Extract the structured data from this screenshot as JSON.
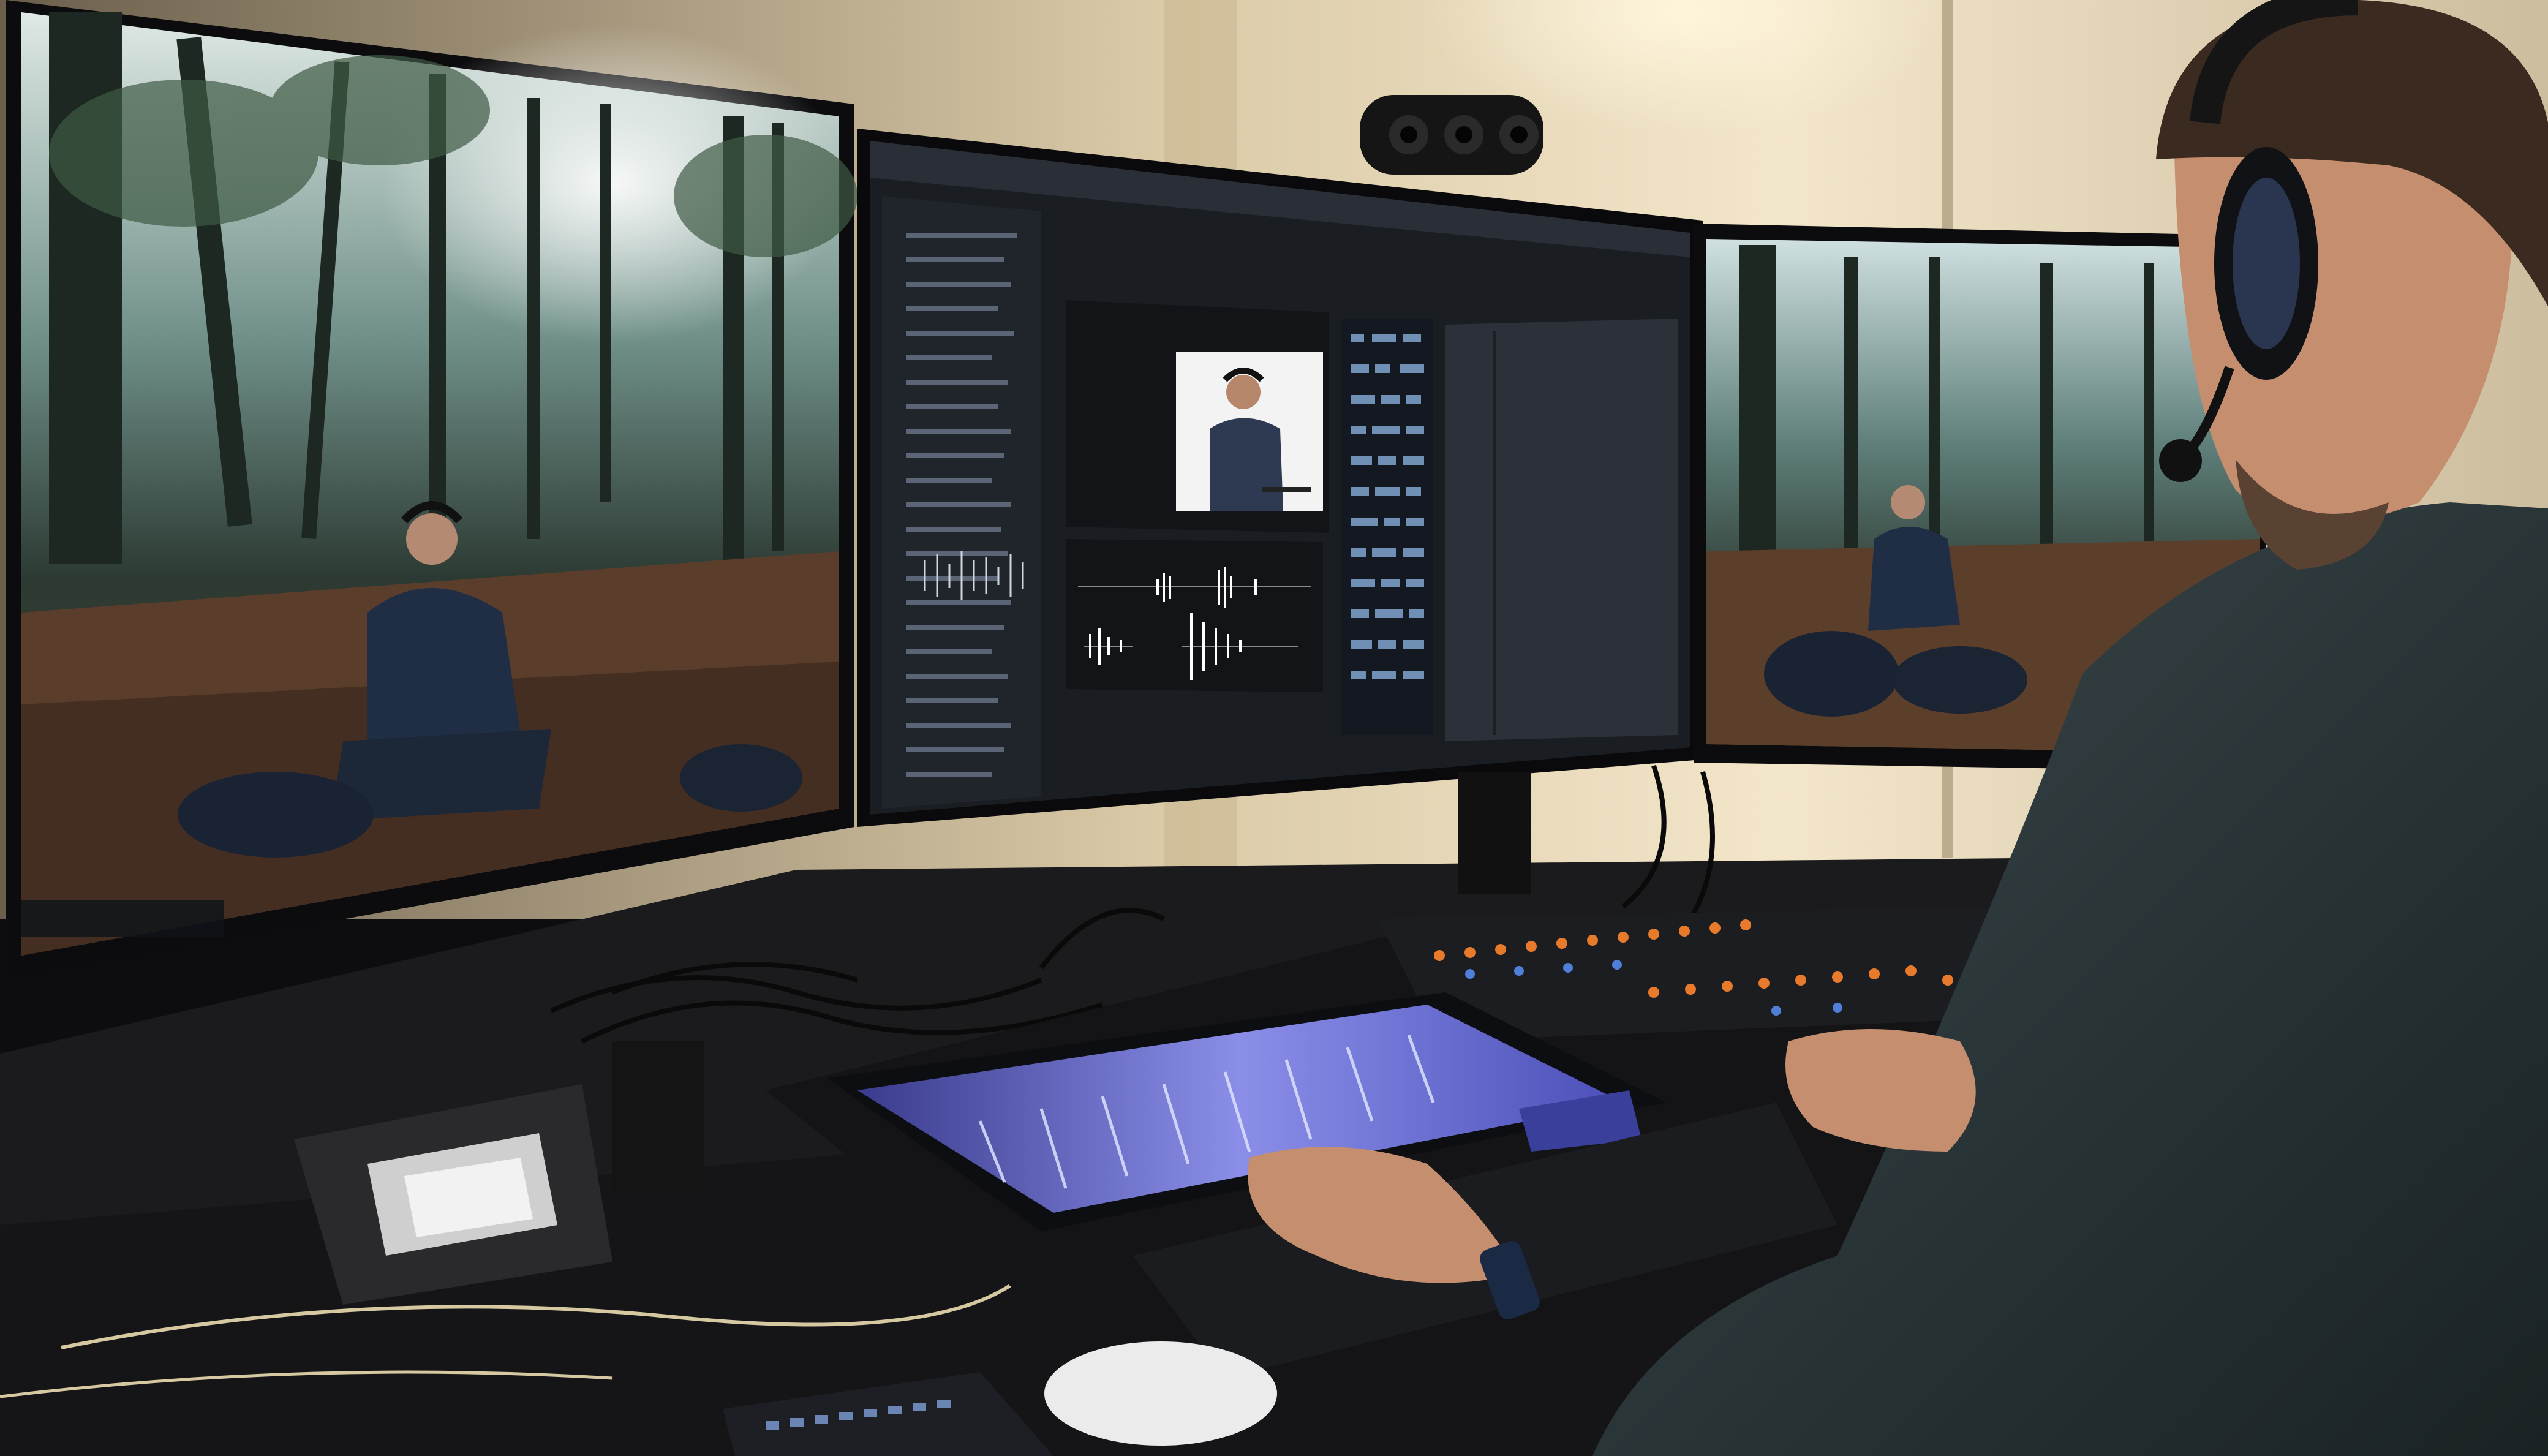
{
  "scene": {
    "description_hidden": "",
    "editor_panel_label": "",
    "monitor_center_brand": "",
    "colors": {
      "wall": "#e9dcc4",
      "wall_light": "#fff3d6",
      "desk": "#1a1a1c",
      "console": "#141416",
      "forest_dark": "#1d2a22",
      "forest_light": "#a9c6cc",
      "ui_bg": "#1b1e24",
      "ui_panel": "#262a32",
      "waveform_purple": "#6f6fd8",
      "meter_orange": "#e87a2b",
      "shirt": "#2d3a3e",
      "skin": "#c48e6f"
    }
  }
}
